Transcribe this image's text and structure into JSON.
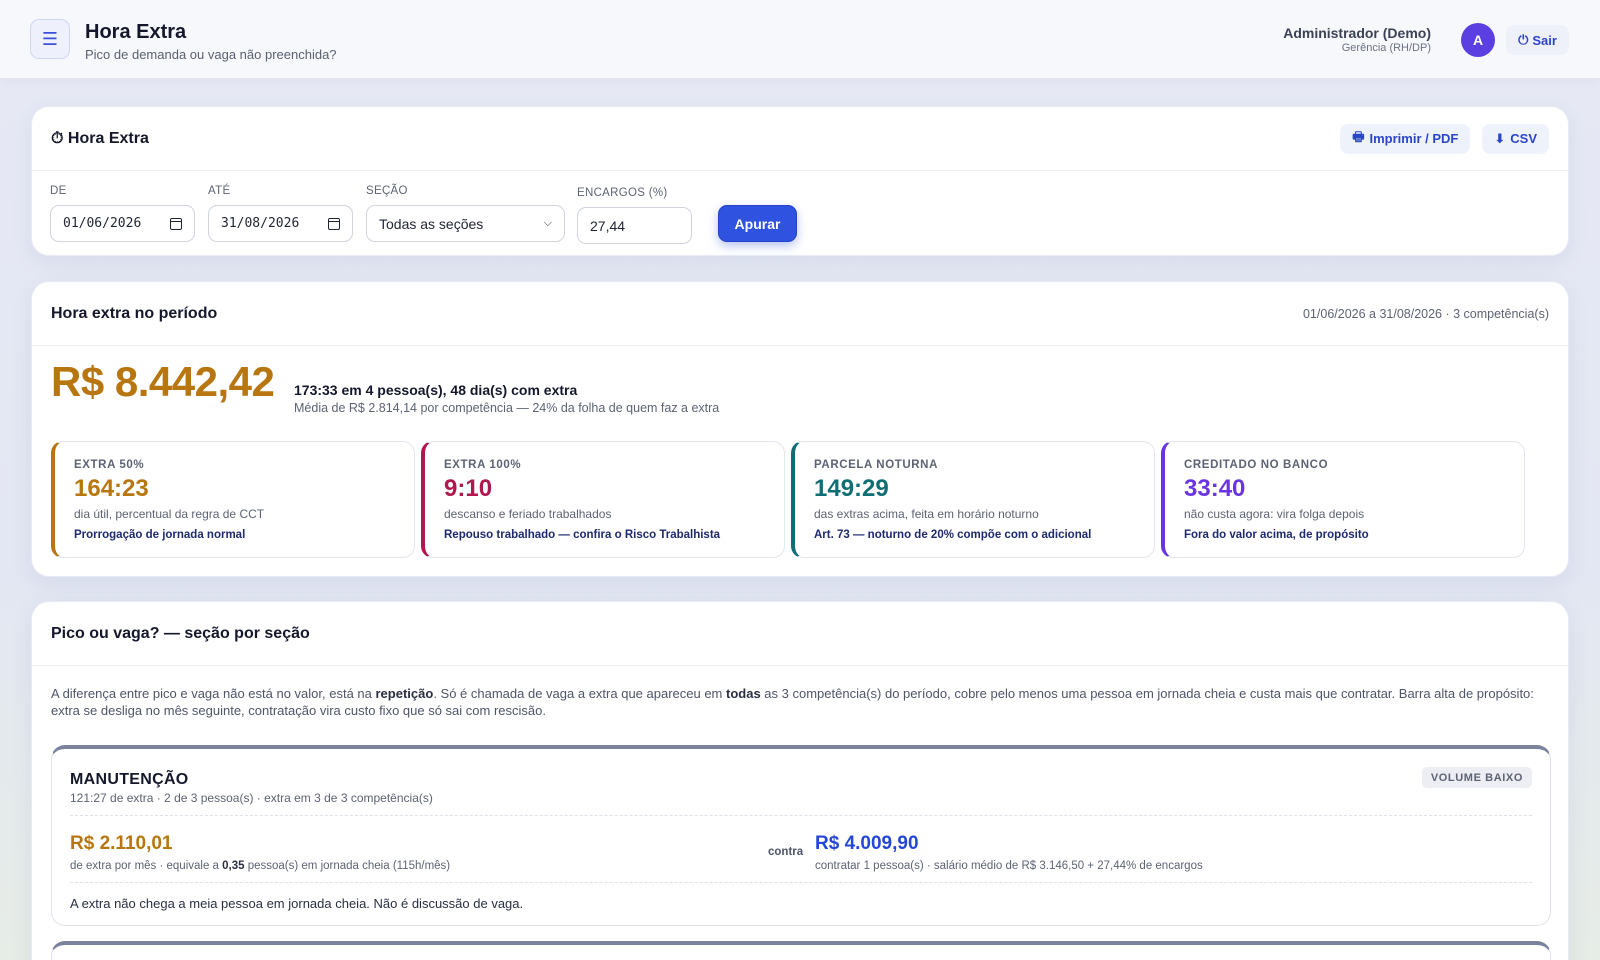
{
  "header": {
    "menu_icon": "hamburger-icon",
    "title": "Hora Extra",
    "subtitle": "Pico de demanda ou vaga não preenchida?",
    "user_name": "Administrador (Demo)",
    "user_role": "Gerência (RH/DP)",
    "avatar_initial": "A",
    "logout_label": "Sair"
  },
  "filters_card": {
    "title": "⏱ Hora Extra",
    "print_label": "Imprimir / PDF",
    "csv_label": "CSV",
    "from_label": "DE",
    "from_value": "01/06/2026",
    "to_label": "ATÉ",
    "to_value": "31/08/2026",
    "section_label": "SEÇÃO",
    "section_value": "Todas as seções",
    "charges_label": "ENCARGOS (%)",
    "charges_value": "27,44",
    "apply_label": "Apurar"
  },
  "period_card": {
    "title": "Hora extra no período",
    "range": "01/06/2026 a 31/08/2026 · 3 competência(s)",
    "total": "R$ 8.442,42",
    "summary": "173:33 em 4 pessoa(s), 48 dia(s) com extra",
    "average": "Média de R$ 2.814,14 por competência — 24% da folha de quem faz a extra",
    "kpis": [
      {
        "label": "EXTRA 50%",
        "value": "164:23",
        "desc": "dia útil, percentual da regra de CCT",
        "note": "Prorrogação de jornada normal",
        "color": "#b7760f"
      },
      {
        "label": "EXTRA 100%",
        "value": "9:10",
        "desc": "descanso e feriado trabalhados",
        "note": "Repouso trabalhado — confira o Risco Trabalhista",
        "color": "#b0174f"
      },
      {
        "label": "PARCELA NOTURNA",
        "value": "149:29",
        "desc": "das extras acima, feita em horário noturno",
        "note": "Art. 73 — noturno de 20% compõe com o adicional",
        "color": "#0f6e74"
      },
      {
        "label": "CREDITADO NO BANCO",
        "value": "33:40",
        "desc": "não custa agora: vira folga depois",
        "note": "Fora do valor acima, de propósito",
        "color": "#6a35e0"
      }
    ]
  },
  "sections_card": {
    "title": "Pico ou vaga? — seção por seção",
    "explain_1": "A diferença entre pico e vaga não está no valor, está na ",
    "explain_b1": "repetição",
    "explain_2": ". Só é chamada de vaga a extra que apareceu em ",
    "explain_b2": "todas",
    "explain_3": " as 3 competência(s) do período, cobre pelo menos uma pessoa em jornada cheia e custa mais que contratar. Barra alta de propósito: extra se desliga no mês seguinte, contratação vira custo fixo que só sai com rescisão.",
    "section": {
      "name": "MANUTENÇÃO",
      "meta": "121:27 de extra · 2 de 3 pessoa(s) · extra em 3 de 3 competência(s)",
      "badge": "VOLUME BAIXO",
      "cost": "R$ 2.110,01",
      "cost_desc_1": "de extra por mês · equivale a ",
      "cost_desc_b": "0,35",
      "cost_desc_2": " pessoa(s) em jornada cheia (115h/mês)",
      "contra": "contra",
      "hire": "R$ 4.009,90",
      "hire_desc": "contratar 1 pessoa(s) · salário médio de R$ 3.146,50 + 27,44% de encargos",
      "verdict": "A extra não chega a meia pessoa em jornada cheia. Não é discussão de vaga."
    }
  }
}
